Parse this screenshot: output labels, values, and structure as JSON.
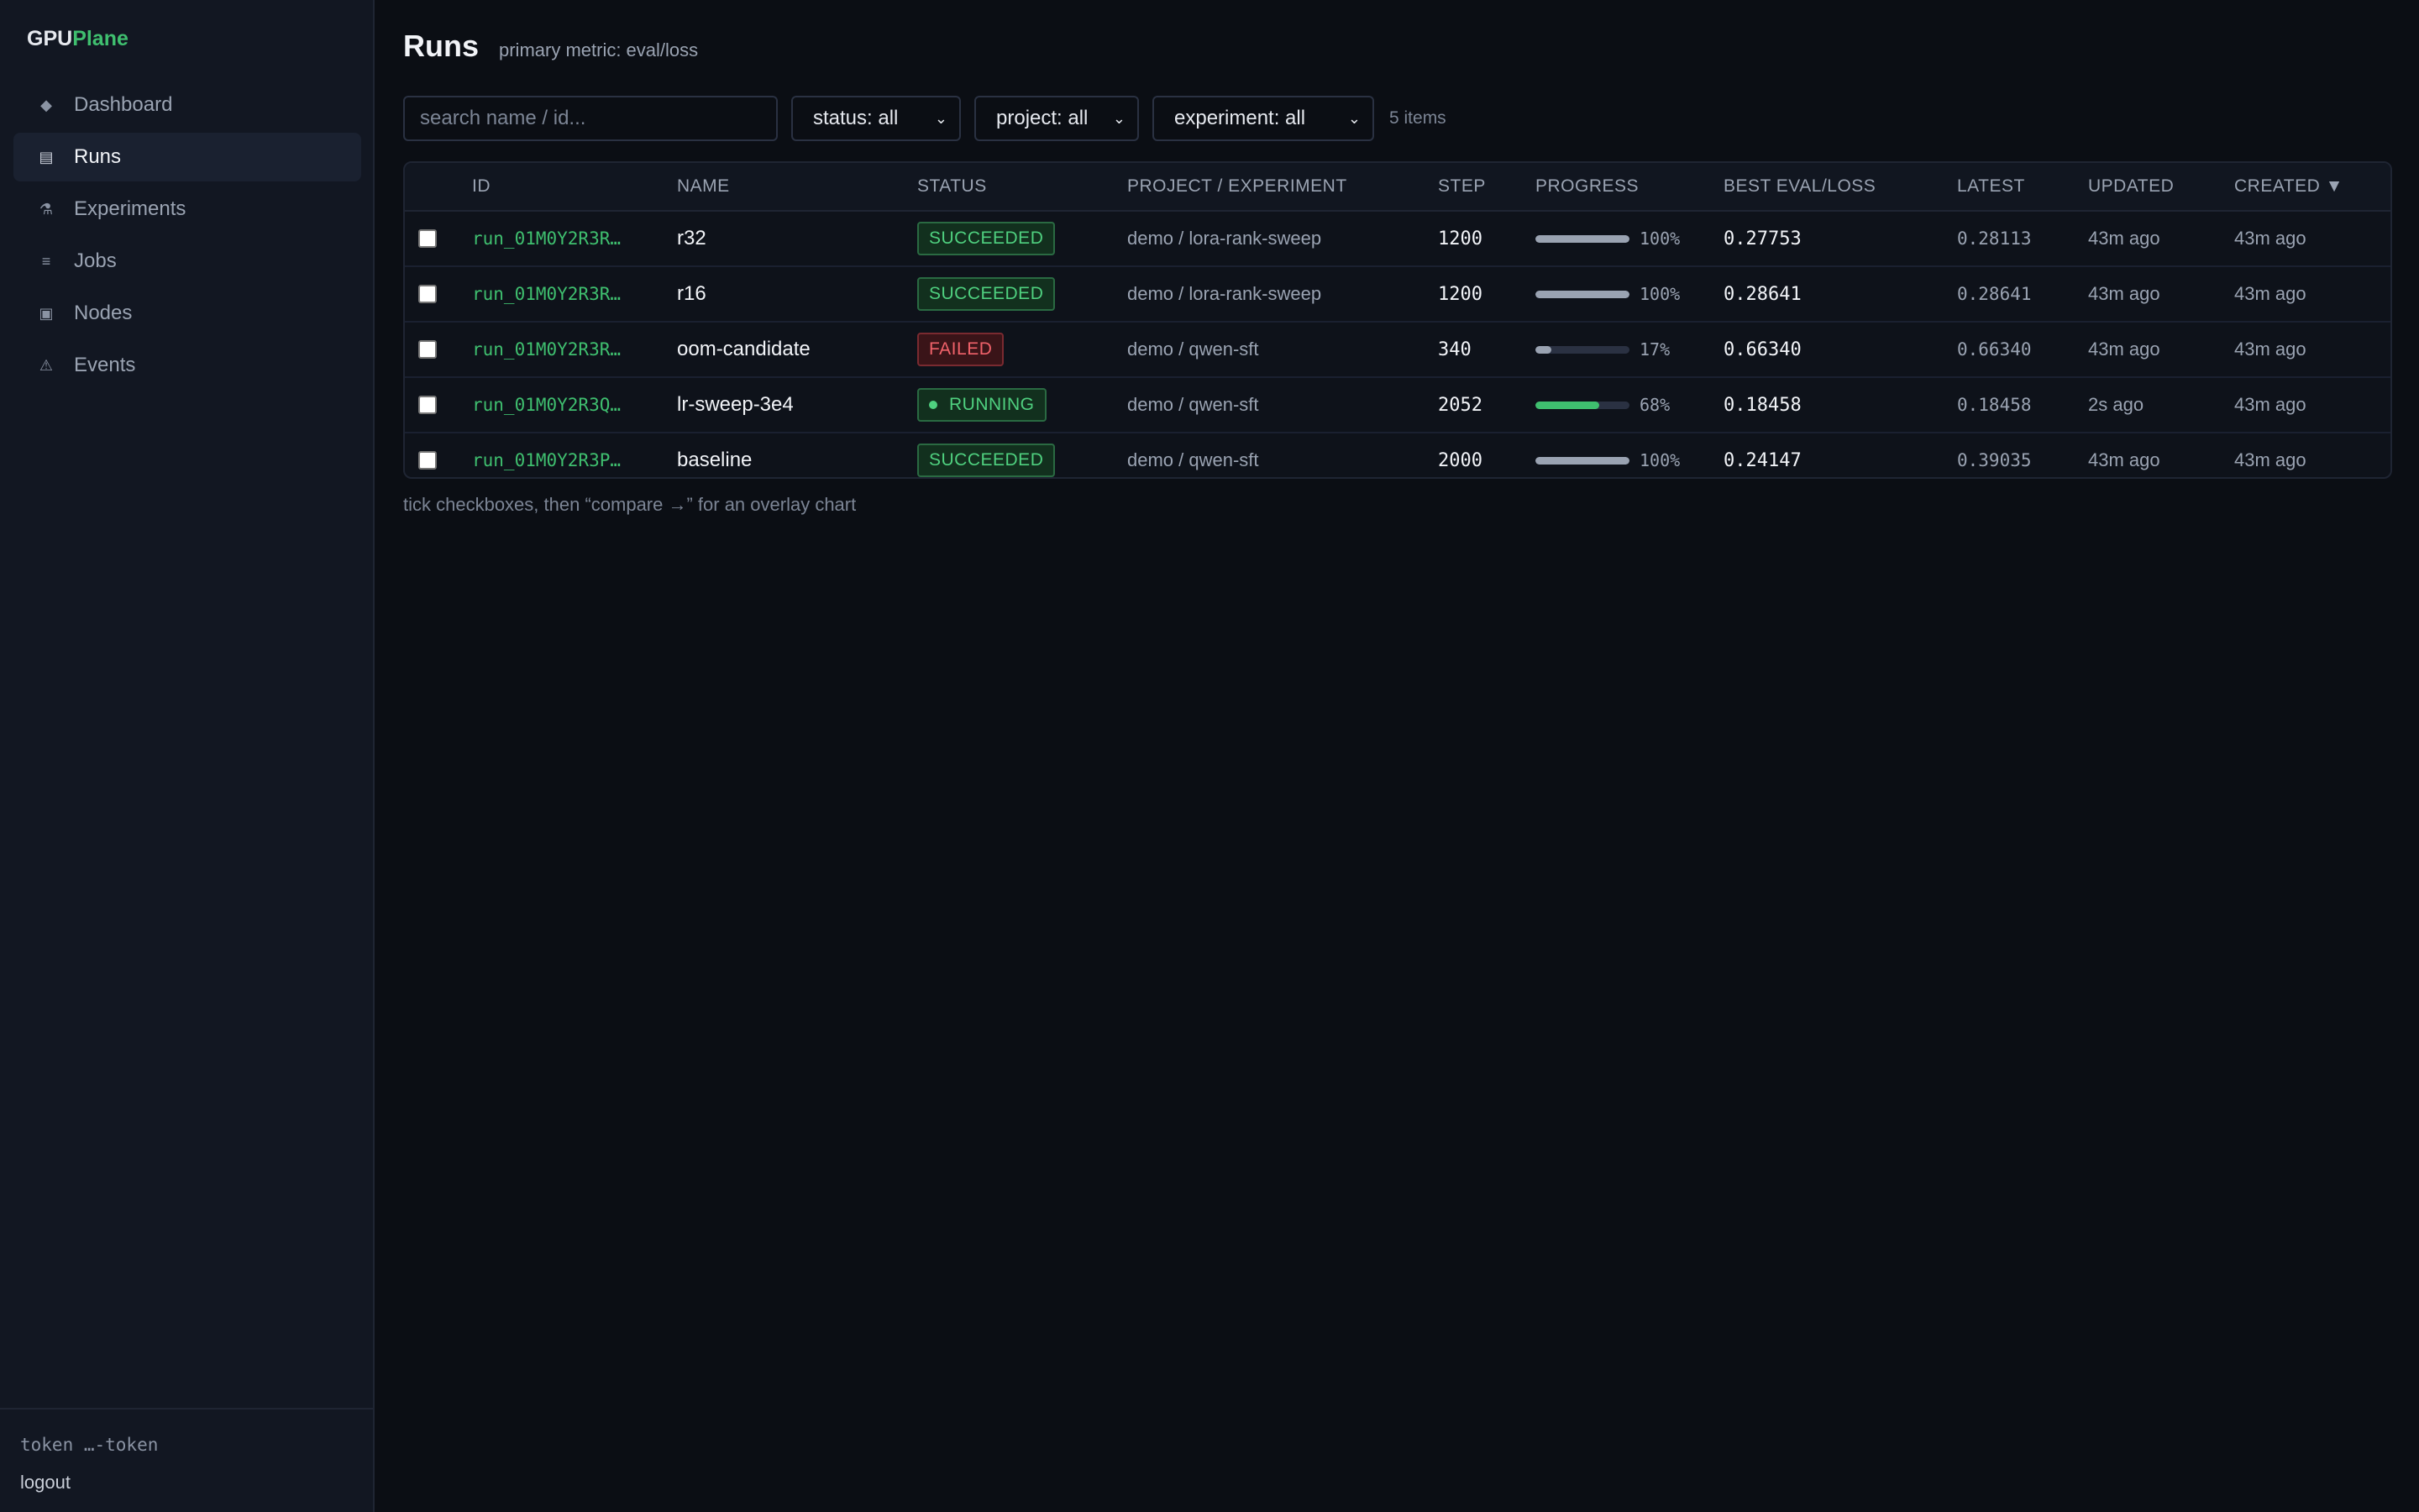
{
  "app": {
    "brand_prefix": "GPU",
    "brand_accent": "Plane",
    "accent_color": "#3fbf6f"
  },
  "sidebar": {
    "items": [
      {
        "label": "Dashboard",
        "icon": "diamond-icon",
        "glyph": "◆"
      },
      {
        "label": "Runs",
        "icon": "runs-icon",
        "glyph": "▤",
        "active": true
      },
      {
        "label": "Experiments",
        "icon": "flask-icon",
        "glyph": "⚗"
      },
      {
        "label": "Jobs",
        "icon": "list-icon",
        "glyph": "≡"
      },
      {
        "label": "Nodes",
        "icon": "node-icon",
        "glyph": "▣"
      },
      {
        "label": "Events",
        "icon": "warning-icon",
        "glyph": "⚠"
      }
    ],
    "token": "token …-token",
    "logout": "logout"
  },
  "header": {
    "title": "Runs",
    "subtitle": "primary metric: eval/loss"
  },
  "filters": {
    "search_placeholder": "search name / id...",
    "status": "status: all",
    "project": "project: all",
    "experiment": "experiment: all",
    "count": "5 items"
  },
  "table": {
    "columns": [
      "ID",
      "NAME",
      "STATUS",
      "PROJECT / EXPERIMENT",
      "STEP",
      "PROGRESS",
      "BEST EVAL/LOSS",
      "LATEST",
      "UPDATED",
      "CREATED ▼"
    ],
    "rows": [
      {
        "id": "run_01M0Y2R3R…",
        "name": "r32",
        "status": "SUCCEEDED",
        "project": "demo / lora-rank-sweep",
        "step": "1200",
        "progress_label": "100%",
        "progress": 100,
        "best": "0.27753",
        "latest": "0.28113",
        "updated": "43m ago",
        "created": "43m ago"
      },
      {
        "id": "run_01M0Y2R3R…",
        "name": "r16",
        "status": "SUCCEEDED",
        "project": "demo / lora-rank-sweep",
        "step": "1200",
        "progress_label": "100%",
        "progress": 100,
        "best": "0.28641",
        "latest": "0.28641",
        "updated": "43m ago",
        "created": "43m ago"
      },
      {
        "id": "run_01M0Y2R3R…",
        "name": "oom-candidate",
        "status": "FAILED",
        "project": "demo / qwen-sft",
        "step": "340",
        "progress_label": "17%",
        "progress": 17,
        "best": "0.66340",
        "latest": "0.66340",
        "updated": "43m ago",
        "created": "43m ago"
      },
      {
        "id": "run_01M0Y2R3Q…",
        "name": "lr-sweep-3e4",
        "status": "RUNNING",
        "project": "demo / qwen-sft",
        "step": "2052",
        "progress_label": "68%",
        "progress": 68,
        "best": "0.18458",
        "latest": "0.18458",
        "updated": "2s ago",
        "created": "43m ago"
      },
      {
        "id": "run_01M0Y2R3P…",
        "name": "baseline",
        "status": "SUCCEEDED",
        "project": "demo / qwen-sft",
        "step": "2000",
        "progress_label": "100%",
        "progress": 100,
        "best": "0.24147",
        "latest": "0.39035",
        "updated": "43m ago",
        "created": "43m ago"
      }
    ]
  },
  "hint": "tick checkboxes, then “compare →” for an overlay chart"
}
